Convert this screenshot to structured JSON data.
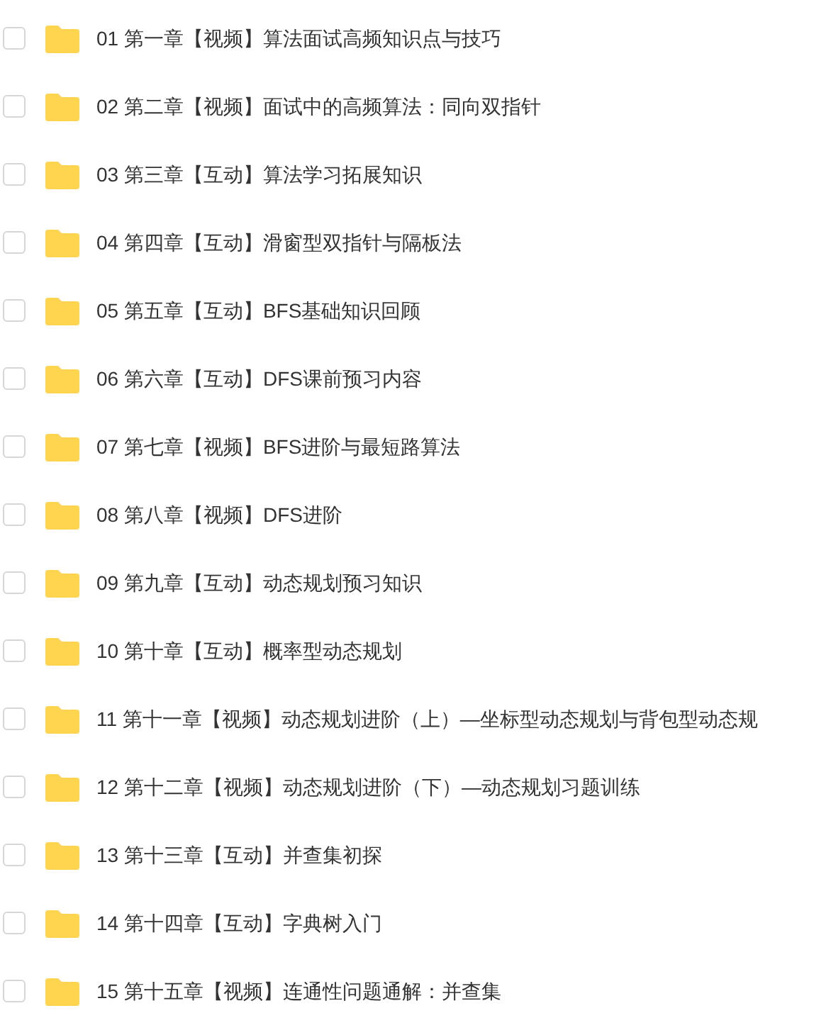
{
  "folders": [
    {
      "name": "01 第一章【视频】算法面试高频知识点与技巧",
      "checked": false
    },
    {
      "name": "02 第二章【视频】面试中的高频算法：同向双指针",
      "checked": false
    },
    {
      "name": "03 第三章【互动】算法学习拓展知识",
      "checked": false
    },
    {
      "name": "04 第四章【互动】滑窗型双指针与隔板法",
      "checked": false
    },
    {
      "name": "05 第五章【互动】BFS基础知识回顾",
      "checked": false
    },
    {
      "name": "06 第六章【互动】DFS课前预习内容",
      "checked": false
    },
    {
      "name": "07 第七章【视频】BFS进阶与最短路算法",
      "checked": false
    },
    {
      "name": "08 第八章【视频】DFS进阶",
      "checked": false
    },
    {
      "name": "09 第九章【互动】动态规划预习知识",
      "checked": false
    },
    {
      "name": "10 第十章【互动】概率型动态规划",
      "checked": false
    },
    {
      "name": "11 第十一章【视频】动态规划进阶（上）—坐标型动态规划与背包型动态规",
      "checked": false
    },
    {
      "name": "12 第十二章【视频】动态规划进阶（下）—动态规划习题训练",
      "checked": false
    },
    {
      "name": "13 第十三章【互动】并查集初探",
      "checked": false
    },
    {
      "name": "14 第十四章【互动】字典树入门",
      "checked": false
    },
    {
      "name": "15 第十五章【视频】连通性问题通解：并查集",
      "checked": false
    }
  ]
}
